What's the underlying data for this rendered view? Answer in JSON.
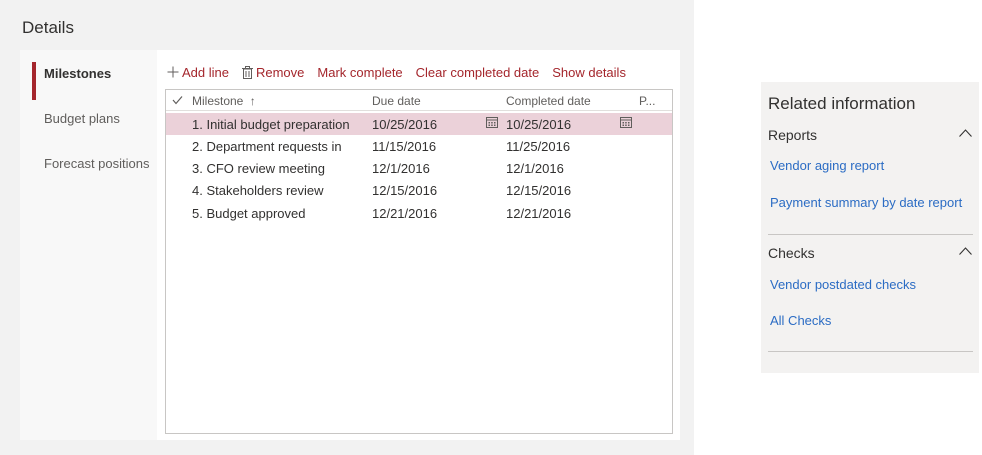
{
  "details": {
    "title": "Details",
    "tabs": [
      {
        "label": "Milestones",
        "active": true
      },
      {
        "label": "Budget plans",
        "active": false
      },
      {
        "label": "Forecast positions",
        "active": false
      }
    ]
  },
  "toolbar": {
    "add_line": "Add line",
    "remove": "Remove",
    "mark_complete": "Mark complete",
    "clear_completed_date": "Clear completed date",
    "show_details": "Show details"
  },
  "grid": {
    "columns": {
      "milestone": "Milestone",
      "sort_indicator": "↑",
      "due_date": "Due date",
      "completed_date": "Completed date",
      "truncated": "P..."
    },
    "rows": [
      {
        "milestone": "1. Initial budget preparation",
        "due_date": "10/25/2016",
        "completed_date": "10/25/2016",
        "selected": true
      },
      {
        "milestone": "2. Department requests in",
        "due_date": "11/15/2016",
        "completed_date": "11/25/2016",
        "selected": false
      },
      {
        "milestone": "3. CFO review meeting",
        "due_date": "12/1/2016",
        "completed_date": "12/1/2016",
        "selected": false
      },
      {
        "milestone": "4. Stakeholders review",
        "due_date": "12/15/2016",
        "completed_date": "12/15/2016",
        "selected": false
      },
      {
        "milestone": "5. Budget approved",
        "due_date": "12/21/2016",
        "completed_date": "12/21/2016",
        "selected": false
      }
    ]
  },
  "related": {
    "title": "Related information",
    "sections": [
      {
        "name": "Reports",
        "links": [
          "Vendor aging report",
          "Payment summary by date report"
        ]
      },
      {
        "name": "Checks",
        "links": [
          "Vendor postdated checks",
          "All Checks"
        ]
      }
    ]
  },
  "colors": {
    "accent": "#a4262c",
    "selected_row": "#ebd1d9",
    "link": "#2b6cc4"
  }
}
